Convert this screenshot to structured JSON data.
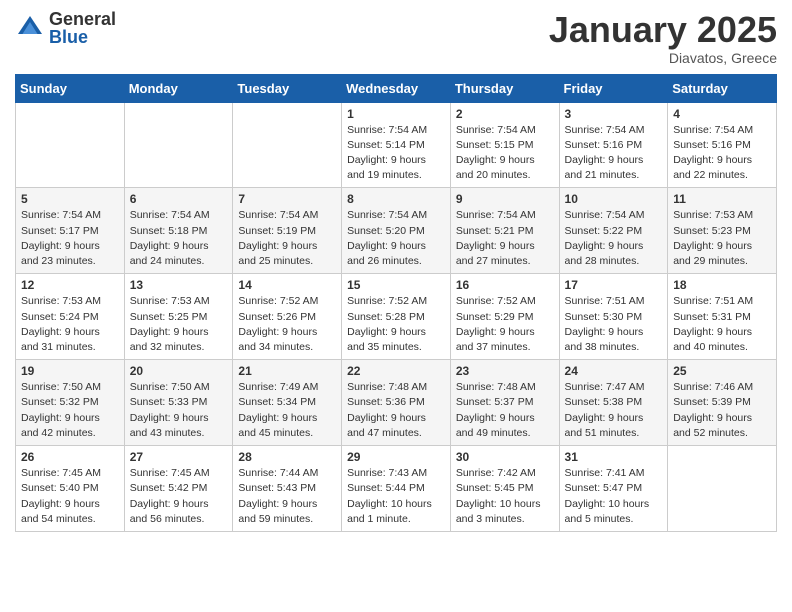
{
  "header": {
    "logo_general": "General",
    "logo_blue": "Blue",
    "month_title": "January 2025",
    "location": "Diavatos, Greece"
  },
  "days_of_week": [
    "Sunday",
    "Monday",
    "Tuesday",
    "Wednesday",
    "Thursday",
    "Friday",
    "Saturday"
  ],
  "weeks": [
    [
      {
        "day": "",
        "info": ""
      },
      {
        "day": "",
        "info": ""
      },
      {
        "day": "",
        "info": ""
      },
      {
        "day": "1",
        "info": "Sunrise: 7:54 AM\nSunset: 5:14 PM\nDaylight: 9 hours\nand 19 minutes."
      },
      {
        "day": "2",
        "info": "Sunrise: 7:54 AM\nSunset: 5:15 PM\nDaylight: 9 hours\nand 20 minutes."
      },
      {
        "day": "3",
        "info": "Sunrise: 7:54 AM\nSunset: 5:16 PM\nDaylight: 9 hours\nand 21 minutes."
      },
      {
        "day": "4",
        "info": "Sunrise: 7:54 AM\nSunset: 5:16 PM\nDaylight: 9 hours\nand 22 minutes."
      }
    ],
    [
      {
        "day": "5",
        "info": "Sunrise: 7:54 AM\nSunset: 5:17 PM\nDaylight: 9 hours\nand 23 minutes."
      },
      {
        "day": "6",
        "info": "Sunrise: 7:54 AM\nSunset: 5:18 PM\nDaylight: 9 hours\nand 24 minutes."
      },
      {
        "day": "7",
        "info": "Sunrise: 7:54 AM\nSunset: 5:19 PM\nDaylight: 9 hours\nand 25 minutes."
      },
      {
        "day": "8",
        "info": "Sunrise: 7:54 AM\nSunset: 5:20 PM\nDaylight: 9 hours\nand 26 minutes."
      },
      {
        "day": "9",
        "info": "Sunrise: 7:54 AM\nSunset: 5:21 PM\nDaylight: 9 hours\nand 27 minutes."
      },
      {
        "day": "10",
        "info": "Sunrise: 7:54 AM\nSunset: 5:22 PM\nDaylight: 9 hours\nand 28 minutes."
      },
      {
        "day": "11",
        "info": "Sunrise: 7:53 AM\nSunset: 5:23 PM\nDaylight: 9 hours\nand 29 minutes."
      }
    ],
    [
      {
        "day": "12",
        "info": "Sunrise: 7:53 AM\nSunset: 5:24 PM\nDaylight: 9 hours\nand 31 minutes."
      },
      {
        "day": "13",
        "info": "Sunrise: 7:53 AM\nSunset: 5:25 PM\nDaylight: 9 hours\nand 32 minutes."
      },
      {
        "day": "14",
        "info": "Sunrise: 7:52 AM\nSunset: 5:26 PM\nDaylight: 9 hours\nand 34 minutes."
      },
      {
        "day": "15",
        "info": "Sunrise: 7:52 AM\nSunset: 5:28 PM\nDaylight: 9 hours\nand 35 minutes."
      },
      {
        "day": "16",
        "info": "Sunrise: 7:52 AM\nSunset: 5:29 PM\nDaylight: 9 hours\nand 37 minutes."
      },
      {
        "day": "17",
        "info": "Sunrise: 7:51 AM\nSunset: 5:30 PM\nDaylight: 9 hours\nand 38 minutes."
      },
      {
        "day": "18",
        "info": "Sunrise: 7:51 AM\nSunset: 5:31 PM\nDaylight: 9 hours\nand 40 minutes."
      }
    ],
    [
      {
        "day": "19",
        "info": "Sunrise: 7:50 AM\nSunset: 5:32 PM\nDaylight: 9 hours\nand 42 minutes."
      },
      {
        "day": "20",
        "info": "Sunrise: 7:50 AM\nSunset: 5:33 PM\nDaylight: 9 hours\nand 43 minutes."
      },
      {
        "day": "21",
        "info": "Sunrise: 7:49 AM\nSunset: 5:34 PM\nDaylight: 9 hours\nand 45 minutes."
      },
      {
        "day": "22",
        "info": "Sunrise: 7:48 AM\nSunset: 5:36 PM\nDaylight: 9 hours\nand 47 minutes."
      },
      {
        "day": "23",
        "info": "Sunrise: 7:48 AM\nSunset: 5:37 PM\nDaylight: 9 hours\nand 49 minutes."
      },
      {
        "day": "24",
        "info": "Sunrise: 7:47 AM\nSunset: 5:38 PM\nDaylight: 9 hours\nand 51 minutes."
      },
      {
        "day": "25",
        "info": "Sunrise: 7:46 AM\nSunset: 5:39 PM\nDaylight: 9 hours\nand 52 minutes."
      }
    ],
    [
      {
        "day": "26",
        "info": "Sunrise: 7:45 AM\nSunset: 5:40 PM\nDaylight: 9 hours\nand 54 minutes."
      },
      {
        "day": "27",
        "info": "Sunrise: 7:45 AM\nSunset: 5:42 PM\nDaylight: 9 hours\nand 56 minutes."
      },
      {
        "day": "28",
        "info": "Sunrise: 7:44 AM\nSunset: 5:43 PM\nDaylight: 9 hours\nand 59 minutes."
      },
      {
        "day": "29",
        "info": "Sunrise: 7:43 AM\nSunset: 5:44 PM\nDaylight: 10 hours\nand 1 minute."
      },
      {
        "day": "30",
        "info": "Sunrise: 7:42 AM\nSunset: 5:45 PM\nDaylight: 10 hours\nand 3 minutes."
      },
      {
        "day": "31",
        "info": "Sunrise: 7:41 AM\nSunset: 5:47 PM\nDaylight: 10 hours\nand 5 minutes."
      },
      {
        "day": "",
        "info": ""
      }
    ]
  ]
}
